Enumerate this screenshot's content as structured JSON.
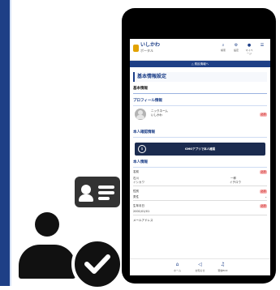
{
  "app": {
    "logo_text": "いしかわ",
    "logo_sub": "ポータル",
    "header_icons": [
      {
        "name": "search-icon",
        "glyph": "⌕",
        "label": "検索"
      },
      {
        "name": "gear-icon",
        "glyph": "⚙",
        "label": "設定"
      },
      {
        "name": "user-icon",
        "glyph": "●",
        "label": "マイページ"
      },
      {
        "name": "menu-icon",
        "glyph": "☰",
        "label": ""
      }
    ],
    "breadcrumb": "△ 県民情報へ"
  },
  "page": {
    "title": "基本情報設定",
    "section_basic": "基本情報",
    "section_profile": "プロフィール情報",
    "profile_name": "ニックネーム",
    "profile_kana": "いしかわ",
    "badge": "必須",
    "section_verify": "本人確認情報",
    "verify_button": "GMOアプリで本人確認",
    "section_person": "本人情報",
    "label_name": "名前",
    "name_last": "石川",
    "name_first": "一郎",
    "name_last_kana": "イシカワ",
    "name_first_kana": "イチロウ",
    "label_gender": "性別",
    "gender_value": "男性",
    "label_birth": "生年月日",
    "birth_value": "2001/01/01",
    "label_email": "メールアドレス"
  },
  "nav": [
    {
      "name": "home-icon",
      "glyph": "⌂",
      "label": "ホーム"
    },
    {
      "name": "megaphone-icon",
      "glyph": "◁",
      "label": "お知らせ"
    },
    {
      "name": "bell-icon",
      "glyph": "♫",
      "label": "受信BOX"
    }
  ],
  "colors": {
    "accent": "#1d3f88",
    "rail": "#1e3f86",
    "badge": "#f7b3b3",
    "dark_button": "#1b2b4f"
  }
}
